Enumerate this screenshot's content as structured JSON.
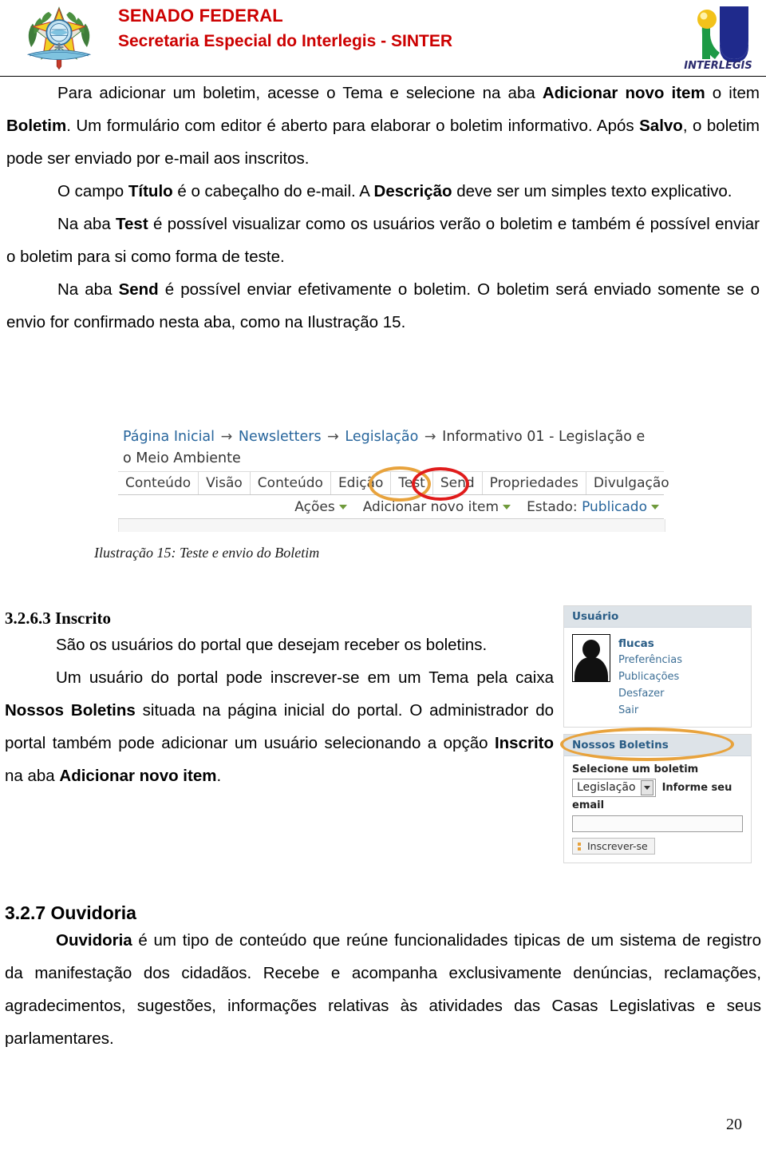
{
  "header": {
    "org_name": "SENADO FEDERAL",
    "org_sub": "Secretaria Especial do Interlegis - SINTER",
    "brasao_icon": "brazil-coat-of-arms-icon",
    "logo_icon": "interlegis-logo-icon",
    "logo_wordmark": "INTERLEGIS",
    "title_color": "#cc0000"
  },
  "paragraphs": {
    "p1_a": "Para adicionar um boletim, acesse o Tema e selecione na aba ",
    "p1_b1": "Adicionar novo item",
    "p1_b": " o item ",
    "p1_b2": "Boletim",
    "p1_c": ". Um formulário com editor é aberto para elaborar o boletim informativo. Após ",
    "p1_b3": "Salvo",
    "p1_d": ", o boletim pode ser enviado por e-mail aos inscritos.",
    "p2_a": "O campo ",
    "p2_b1": "Título",
    "p2_b": " é o cabeçalho do e-mail. A ",
    "p2_b2": "Descrição",
    "p2_c": " deve ser um simples texto explicativo.",
    "p3_a": "Na aba ",
    "p3_b1": "Test",
    "p3_b": " é possível visualizar como os usuários verão o boletim e também é possível enviar o boletim para si como forma de teste.",
    "p4_a": "Na aba ",
    "p4_b1": "Send",
    "p4_b": " é possível enviar efetivamente o boletim. O boletim será enviado somente se o envio for confirmado nesta aba, como na Ilustração 15."
  },
  "figure": {
    "caption": "Ilustração 15: Teste e envio do Boletim",
    "breadcrumb": {
      "items": [
        "Página Inicial",
        "Newsletters",
        "Legislação"
      ],
      "arrow": "→",
      "current": "Informativo 01 - Legislação e o Meio Ambiente"
    },
    "tabs": [
      "Conteúdo",
      "Visão",
      "Conteúdo",
      "Edição",
      "Test",
      "Send",
      "Propriedades",
      "Divulgação"
    ],
    "highlighted_tabs": [
      {
        "label": "Test",
        "color": "#e8a33d"
      },
      {
        "label": "Send",
        "color": "#e01b1b"
      }
    ],
    "actions": {
      "acoes": "Ações",
      "adicionar": "Adicionar novo item",
      "estado_label": "Estado:",
      "estado_value": "Publicado"
    }
  },
  "section_inscrito": {
    "heading": "3.2.6.3 Inscrito",
    "p1": "São os usuários do portal que desejam receber os boletins.",
    "p2_a": "Um usuário do portal pode inscrever-se em um Tema pela caixa ",
    "p2_b1": "Nossos Boletins",
    "p2_b": " situada na página inicial do portal. O administrador do portal também pode adicionar um usuário selecionando a opção ",
    "p2_b2": "Inscrito",
    "p2_c": " na aba ",
    "p2_b3": "Adicionar novo item",
    "p2_d": "."
  },
  "portlets": {
    "user": {
      "title": "Usuário",
      "username": "flucas",
      "links": [
        "Preferências",
        "Publicações",
        "Desfazer",
        "Sair"
      ],
      "avatar_icon": "user-silhouette-icon"
    },
    "newsletters": {
      "title": "Nossos Boletins",
      "select_label": "Selecione um boletim",
      "select_value": "Legislação",
      "email_label_a": "Informe seu",
      "email_label_b": "email",
      "email_value": "",
      "subscribe_label": "Inscrever-se",
      "highlight_color": "#e8a33d"
    }
  },
  "section_ouvidoria": {
    "heading": "3.2.7 Ouvidoria",
    "p1_b1": "Ouvidoria",
    "p1_a": " é um tipo de conteúdo que reúne funcionalidades tipicas de um sistema de registro da manifestação dos cidadãos. Recebe e acompanha exclusivamente denúncias, reclamações, agradecimentos, sugestões, informações relativas às atividades das Casas Legislativas e seus parlamentares."
  },
  "footer": {
    "page_number": "20"
  }
}
